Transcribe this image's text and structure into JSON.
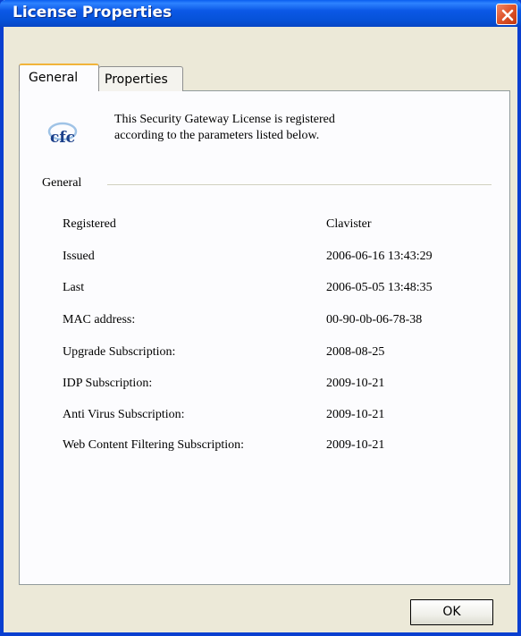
{
  "window": {
    "title": "License Properties"
  },
  "icons": {
    "close": "close-icon",
    "logo": "cfc-logo"
  },
  "tabs": [
    {
      "label": "General",
      "selected": true
    },
    {
      "label": "Properties",
      "selected": false
    }
  ],
  "intro": {
    "line1": "This Security Gateway License is registered",
    "line2": "according to the parameters listed below."
  },
  "group": {
    "label": "General"
  },
  "properties": [
    {
      "label": "Registered",
      "value": "Clavister"
    },
    {
      "label": "Issued",
      "value": "2006-06-16 13:43:29"
    },
    {
      "label": "Last",
      "value": "2006-05-05 13:48:35"
    },
    {
      "label": "MAC address:",
      "value": "00-90-0b-06-78-38"
    },
    {
      "label": "Upgrade Subscription:",
      "value": "2008-08-25"
    },
    {
      "label": "IDP Subscription:",
      "value": "2009-10-21"
    },
    {
      "label": "Anti Virus Subscription:",
      "value": "2009-10-21"
    },
    {
      "label": "Web Content Filtering Subscription:",
      "value": "2009-10-21"
    }
  ],
  "buttons": {
    "ok": "OK"
  },
  "colors": {
    "titlebar": "#0b58e6",
    "close_button": "#e0572e",
    "dialog_bg": "#ece9d8",
    "panel_bg": "#fcfcfe",
    "selected_tab_accent": "#f1b43a"
  }
}
